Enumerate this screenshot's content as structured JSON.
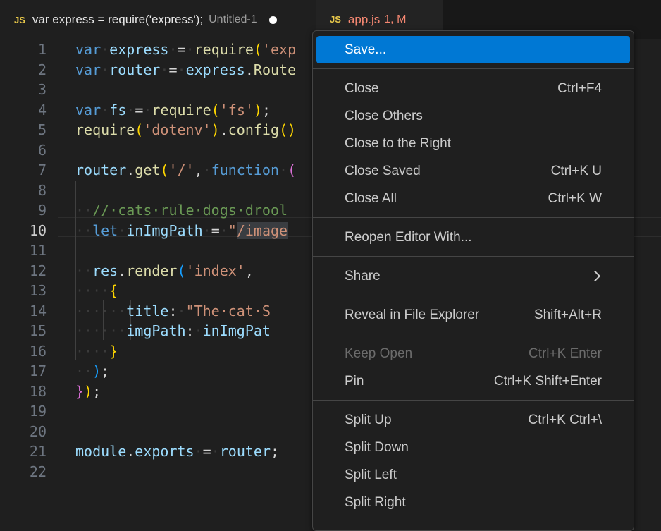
{
  "tabs": [
    {
      "icon": "JS",
      "title": "var express = require('express');",
      "description": "Untitled-1",
      "dirty": true
    },
    {
      "icon": "JS",
      "title": "app.js",
      "status": "1, M"
    }
  ],
  "editor": {
    "line_numbers": [
      "1",
      "2",
      "3",
      "4",
      "5",
      "6",
      "7",
      "8",
      "9",
      "10",
      "11",
      "12",
      "13",
      "14",
      "15",
      "16",
      "17",
      "18",
      "19",
      "20",
      "21",
      "22"
    ],
    "active_line": "10"
  },
  "menu": {
    "items": {
      "save": {
        "label": "Save...",
        "shortcut": ""
      },
      "close": {
        "label": "Close",
        "shortcut": "Ctrl+F4"
      },
      "close_others": {
        "label": "Close Others",
        "shortcut": ""
      },
      "close_right": {
        "label": "Close to the Right",
        "shortcut": ""
      },
      "close_saved": {
        "label": "Close Saved",
        "shortcut": "Ctrl+K U"
      },
      "close_all": {
        "label": "Close All",
        "shortcut": "Ctrl+K W"
      },
      "reopen_with": {
        "label": "Reopen Editor With...",
        "shortcut": ""
      },
      "share": {
        "label": "Share",
        "shortcut": ""
      },
      "reveal": {
        "label": "Reveal in File Explorer",
        "shortcut": "Shift+Alt+R"
      },
      "keep_open": {
        "label": "Keep Open",
        "shortcut": "Ctrl+K Enter"
      },
      "pin": {
        "label": "Pin",
        "shortcut": "Ctrl+K Shift+Enter"
      },
      "split_up": {
        "label": "Split Up",
        "shortcut": "Ctrl+K Ctrl+\\"
      },
      "split_down": {
        "label": "Split Down",
        "shortcut": ""
      },
      "split_left": {
        "label": "Split Left",
        "shortcut": ""
      },
      "split_right": {
        "label": "Split Right",
        "shortcut": ""
      }
    }
  },
  "colors": {
    "accent": "#0078d4",
    "modified": "#f48771",
    "js_icon": "#e8c84a"
  }
}
